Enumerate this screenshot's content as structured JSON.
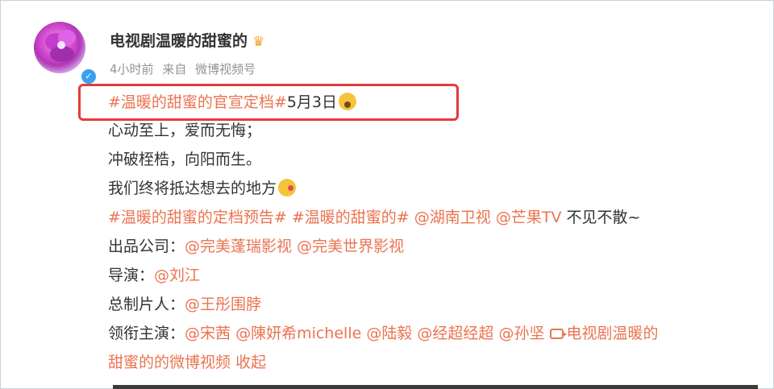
{
  "post": {
    "author": "电视剧温暖的甜蜜的",
    "author_badge": "crown-icon",
    "verified_badge": "✓",
    "time": "4小时前",
    "source_label": "来自",
    "source": "微博视频号",
    "lines": {
      "l1_tag": "#温暖的甜蜜的官宣定档#",
      "l1_text": "5月3日",
      "l2": "心动至上，爱而无悔；",
      "l3": "冲破桎梏，向阳而生。",
      "l4": "我们终将抵达想去的地方",
      "l5_tag1": "#温暖的甜蜜的定档预告#",
      "l5_tag2": "#温暖的甜蜜的#",
      "l5_m1": "@湖南卫视",
      "l5_m2": "@芒果TV",
      "l5_text": "不见不散~",
      "l6_label": "出品公司：",
      "l6_m1": "@完美蓬瑞影视",
      "l6_m2": "@完美世界影视",
      "l7_label": "导演：",
      "l7_m1": "@刘江",
      "l8_label": "总制片人：",
      "l8_m1": "@王彤围脖",
      "l9_label": "领衔主演：",
      "l9_m1": "@宋茜",
      "l9_m2": "@陳妍希michelle",
      "l9_m3": "@陆毅",
      "l9_m4": "@经超经超",
      "l9_m5": "@孙坚",
      "l9_video": "电视剧温暖的",
      "l10_video": "甜蜜的的微博视频",
      "l10_collapse": "收起"
    }
  },
  "colors": {
    "link": "#eb7350",
    "highlight_border": "#e53b3b",
    "verified": "#3aa0f3"
  }
}
